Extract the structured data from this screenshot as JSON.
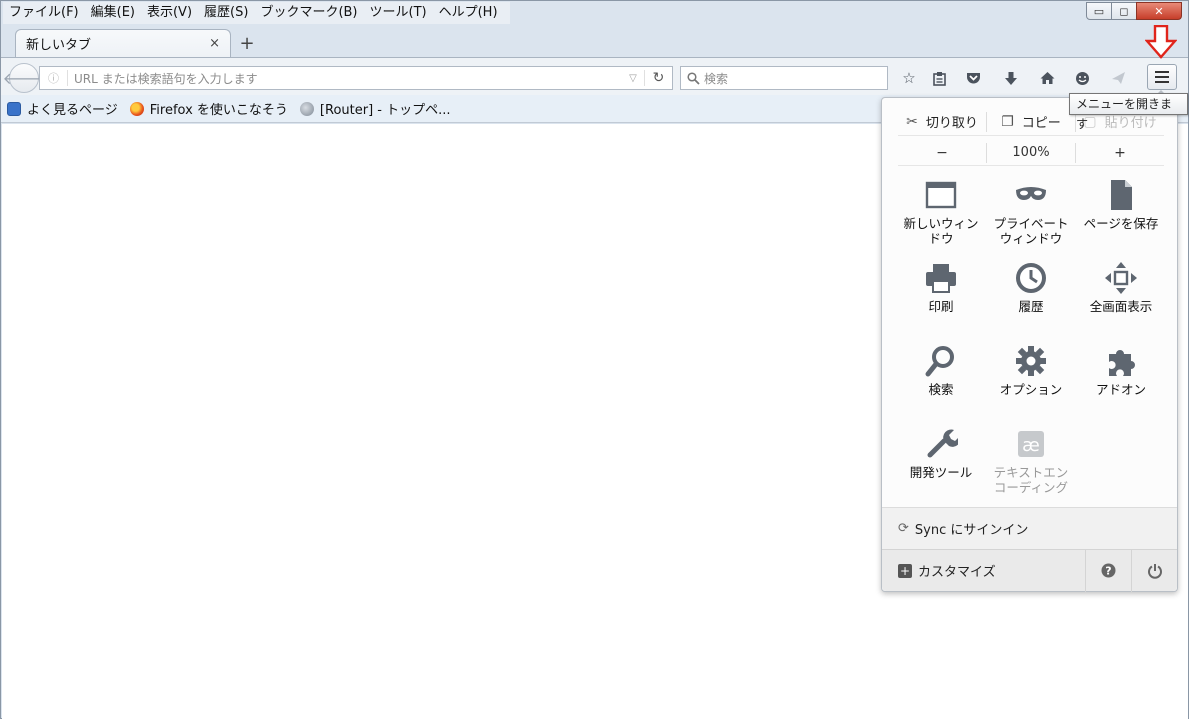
{
  "menubar": [
    {
      "label": "ファイル(F)"
    },
    {
      "label": "編集(E)"
    },
    {
      "label": "表示(V)"
    },
    {
      "label": "履歴(S)"
    },
    {
      "label": "ブックマーク(B)"
    },
    {
      "label": "ツール(T)"
    },
    {
      "label": "ヘルプ(H)"
    }
  ],
  "tab": {
    "title": "新しいタブ",
    "close": "×",
    "new_tab": "+"
  },
  "urlbar": {
    "placeholder": "URL または検索語句を入力します"
  },
  "searchbar": {
    "placeholder": "検索"
  },
  "bookmarks": [
    {
      "label": "よく見るページ",
      "icon": "most-visited-icon"
    },
    {
      "label": "Firefox を使いこなそう",
      "icon": "firefox-icon"
    },
    {
      "label": "[Router] - トップペ...",
      "icon": "globe-icon"
    }
  ],
  "tooltip": "メニューを開きます",
  "panel": {
    "edit": {
      "cut": "切り取り",
      "copy": "コピー",
      "paste": "貼り付け"
    },
    "zoom": {
      "minus": "−",
      "value": "100%",
      "plus": "+"
    },
    "items": [
      {
        "label": "新しいウィンドウ",
        "icon": "new-window-icon"
      },
      {
        "label": "プライベートウィンドウ",
        "icon": "private-window-icon"
      },
      {
        "label": "ページを保存",
        "icon": "save-page-icon"
      },
      {
        "label": "印刷",
        "icon": "print-icon"
      },
      {
        "label": "履歴",
        "icon": "history-icon"
      },
      {
        "label": "全画面表示",
        "icon": "fullscreen-icon"
      },
      {
        "label": "検索",
        "icon": "search-icon"
      },
      {
        "label": "オプション",
        "icon": "options-icon"
      },
      {
        "label": "アドオン",
        "icon": "addons-icon"
      },
      {
        "label": "開発ツール",
        "icon": "developer-icon"
      },
      {
        "label": "テキストエンコーディング",
        "icon": "text-encoding-icon"
      }
    ],
    "sync": "Sync にサインイン",
    "customize": "カスタマイズ"
  },
  "colors": {
    "arrow": "#e0241b",
    "panel_bg": "#fcfcfc",
    "icon": "#5e6670"
  }
}
